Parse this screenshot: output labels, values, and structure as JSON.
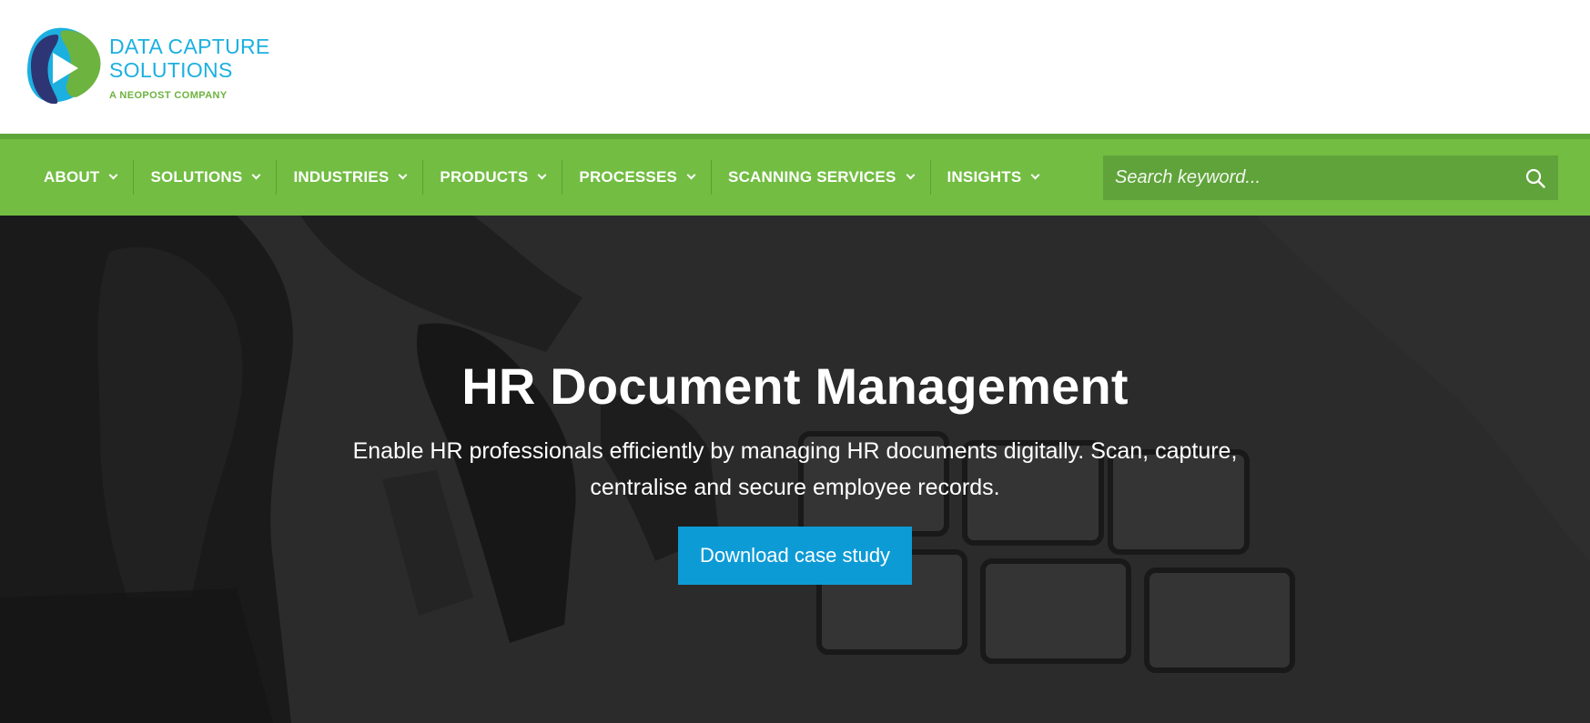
{
  "header": {
    "logo": {
      "line1": "DATA CAPTURE",
      "line2": "SOLUTIONS",
      "tagline": "A NEOPOST COMPANY"
    }
  },
  "nav": {
    "items": [
      {
        "label": "ABOUT"
      },
      {
        "label": "SOLUTIONS"
      },
      {
        "label": "INDUSTRIES"
      },
      {
        "label": "PRODUCTS"
      },
      {
        "label": "PROCESSES"
      },
      {
        "label": "SCANNING SERVICES"
      },
      {
        "label": "INSIGHTS"
      }
    ],
    "search": {
      "placeholder": "Search keyword...",
      "value": ""
    }
  },
  "hero": {
    "title": "HR Document Management",
    "subtitle": "Enable HR professionals efficiently by managing HR documents digitally. Scan, capture, centralise and secure employee records.",
    "cta_label": "Download case study"
  },
  "colors": {
    "brand_green": "#72bd42",
    "brand_blue": "#1cb0e0",
    "cta_blue": "#0d9bd6"
  }
}
